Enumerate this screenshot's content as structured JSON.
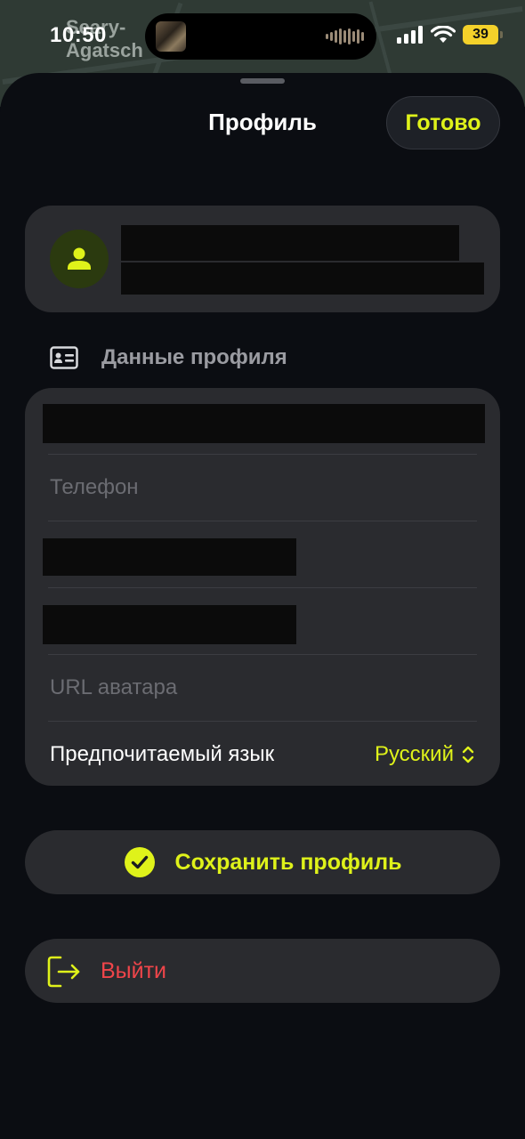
{
  "status_bar": {
    "time": "10:50",
    "battery": "39",
    "map_label": "Seary-Agatsch"
  },
  "sheet": {
    "title": "Профиль",
    "done_label": "Готово"
  },
  "profile_section": {
    "header_label": "Данные профиля",
    "phone_placeholder": "Телефон",
    "avatar_url_placeholder": "URL аватара",
    "language_label": "Предпочитаемый язык",
    "language_value": "Русский"
  },
  "actions": {
    "save_label": "Сохранить профиль",
    "logout_label": "Выйти"
  },
  "colors": {
    "accent": "#dff21a",
    "danger": "#f0454a",
    "card": "#2a2b2f",
    "background": "#0b0d12"
  },
  "icons": {
    "avatar": "person-icon",
    "section": "id-card-icon",
    "language": "chevron-up-down-icon",
    "save": "checkmark-circle-icon",
    "logout": "logout-icon"
  }
}
